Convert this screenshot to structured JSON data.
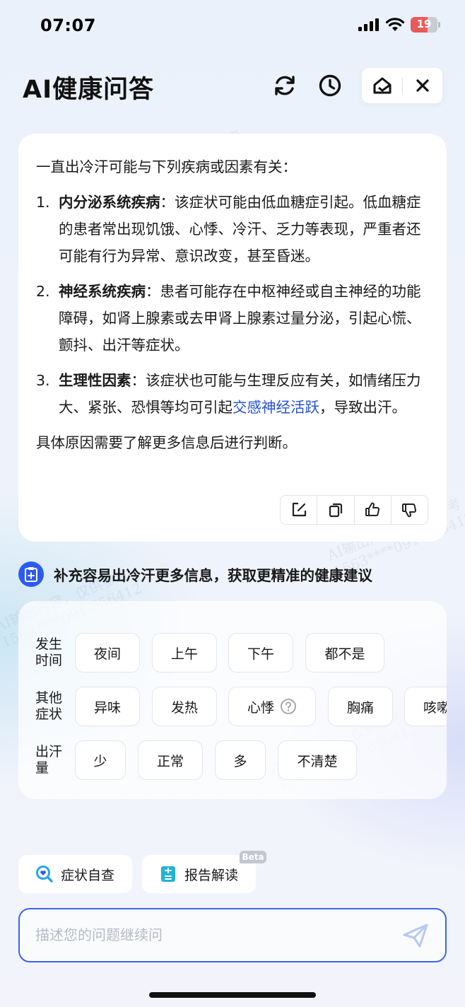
{
  "status_bar": {
    "time": "07:07",
    "battery": "19"
  },
  "header": {
    "title": "AI健康问答"
  },
  "answer": {
    "intro": "一直出冷汗可能与下列疾病或因素有关：",
    "items": [
      {
        "num": "1.",
        "title": "内分泌系统疾病",
        "text": "：该症状可能由低血糖症引起。低血糖症的患者常出现饥饿、心悸、冷汗、乏力等表现，严重者还可能有行为异常、意识改变，甚至昏迷。"
      },
      {
        "num": "2.",
        "title": "神经系统疾病",
        "text": "：患者可能存在中枢神经或自主神经的功能障碍，如肾上腺素或去甲肾上腺素过量分泌，引起心慌、颤抖、出汗等症状。"
      },
      {
        "num": "3.",
        "title": "生理性因素",
        "text_before": "：该症状也可能与生理反应有关，如情绪压力大、紧张、恐惧等均可引起",
        "link": "交感神经活跃",
        "text_after": "，导致出汗。"
      }
    ],
    "outro": "具体原因需要了解更多信息后进行判断。"
  },
  "supplement": {
    "title": "补充容易出冷汗更多信息，获取更精准的健康建议",
    "groups": [
      {
        "label": "发生时间",
        "options": [
          "夜间",
          "上午",
          "下午",
          "都不是"
        ]
      },
      {
        "label": "其他症状",
        "options": [
          "异味",
          "发热",
          "心悸",
          "胸痛",
          "咳嗽"
        ]
      },
      {
        "label": "出汗量",
        "options": [
          "少",
          "正常",
          "多",
          "不清楚"
        ]
      }
    ]
  },
  "tools": {
    "symptom_check": "症状自查",
    "report_read": "报告解读",
    "beta": "Beta"
  },
  "input": {
    "placeholder": "描述您的问题继续问"
  },
  "watermark": {
    "line1": "AI输出内容，仅供参考",
    "line2": "1563****091  856412"
  },
  "colors": {
    "accent": "#3966ee",
    "link": "#2553d6",
    "supp_icon_bg": "#2c5bf0"
  }
}
